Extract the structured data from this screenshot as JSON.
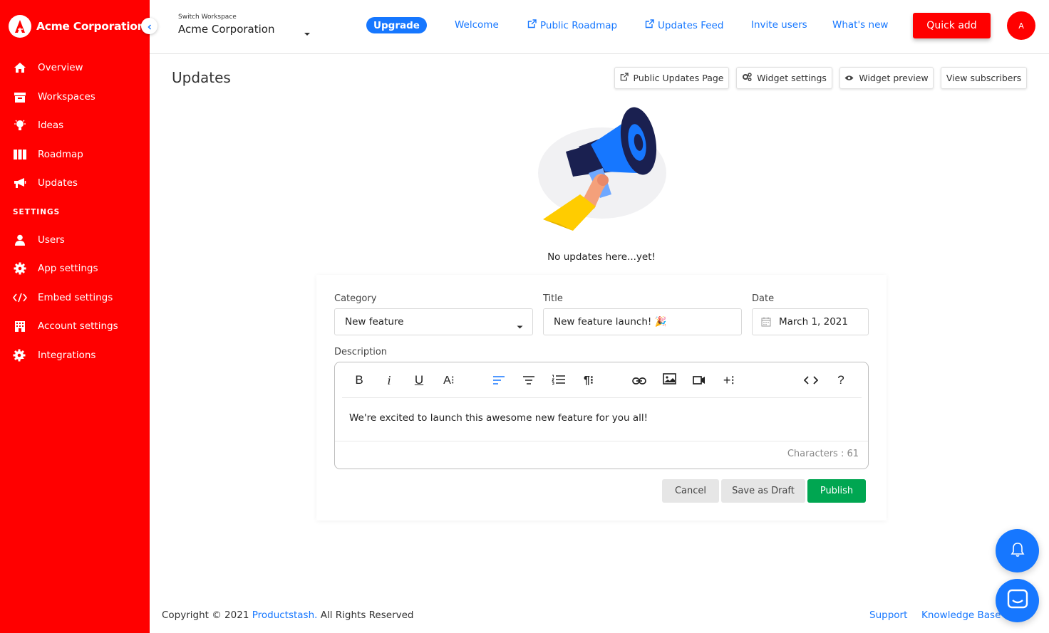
{
  "brand": {
    "name": "Acme Corporation",
    "logo_letter": "A"
  },
  "sidebar": {
    "items": [
      {
        "label": "Overview",
        "icon": "home-icon"
      },
      {
        "label": "Workspaces",
        "icon": "archive-icon"
      },
      {
        "label": "Ideas",
        "icon": "lightbulb-icon"
      },
      {
        "label": "Roadmap",
        "icon": "columns-icon"
      },
      {
        "label": "Updates",
        "icon": "megaphone-icon"
      }
    ],
    "settings_heading": "SETTINGS",
    "settings_items": [
      {
        "label": "Users",
        "icon": "user-icon"
      },
      {
        "label": "App settings",
        "icon": "gear-icon"
      },
      {
        "label": "Embed settings",
        "icon": "code-icon"
      },
      {
        "label": "Account settings",
        "icon": "building-icon"
      },
      {
        "label": "Integrations",
        "icon": "api-gear-icon"
      }
    ]
  },
  "topbar": {
    "switch_label": "Switch Workspace",
    "workspace_name": "Acme Corporation",
    "upgrade": "Upgrade",
    "links": [
      "Welcome",
      "Public Roadmap",
      "Updates Feed",
      "Invite users",
      "What's new"
    ],
    "quick_add": "Quick add",
    "avatar": "A"
  },
  "page": {
    "title": "Updates",
    "header_buttons": [
      "Public Updates Page",
      "Widget settings",
      "Widget preview",
      "View subscribers"
    ],
    "empty_text": "No updates here...yet!"
  },
  "form": {
    "category_label": "Category",
    "category_value": "New feature",
    "title_label": "Title",
    "title_value": "New feature launch! 🎉",
    "date_label": "Date",
    "date_value": "March 1, 2021",
    "description_label": "Description",
    "description_text": "We're excited to launch this awesome new feature for you all!",
    "char_count": "Characters : 61",
    "cancel": "Cancel",
    "save_draft": "Save as Draft",
    "publish": "Publish"
  },
  "footer": {
    "copyright_prefix": "Copyright © 2021 ",
    "company_link": "Productstash.",
    "copyright_suffix": " All Rights Reserved",
    "support": "Support",
    "knowledge_base": "Knowledge Base"
  },
  "colors": {
    "brand_red": "#ff0000",
    "link_blue": "#1677ff",
    "publish_green": "#00a651"
  }
}
